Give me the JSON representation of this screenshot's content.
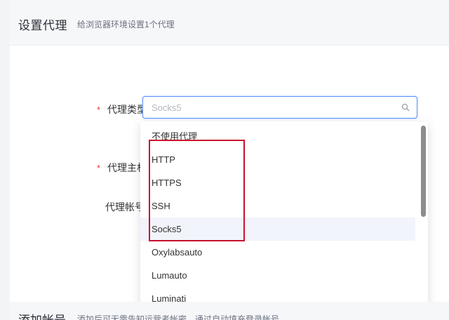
{
  "proxy_section": {
    "title": "设置代理",
    "subtitle": "给浏览器环境设置1个代理"
  },
  "form": {
    "proxy_type_label": "代理类型",
    "proxy_host_label": "代理主机",
    "proxy_account_label": "代理帐号",
    "required_mark": "*",
    "proxy_type_value": "Socks5"
  },
  "dropdown": {
    "items": [
      {
        "label": "不使用代理"
      },
      {
        "label": "HTTP"
      },
      {
        "label": "HTTPS"
      },
      {
        "label": "SSH"
      },
      {
        "label": "Socks5"
      },
      {
        "label": "Oxylabsauto"
      },
      {
        "label": "Lumauto"
      },
      {
        "label": "Luminati"
      }
    ],
    "selected_index": 4
  },
  "account_section": {
    "title": "添加帐号",
    "subtitle": "添加后可无需告知运营者帐密，通过自动填充登录帐号"
  },
  "colors": {
    "accent": "#5b8ff9",
    "highlight": "#c8102e",
    "required": "#e33b3b"
  }
}
